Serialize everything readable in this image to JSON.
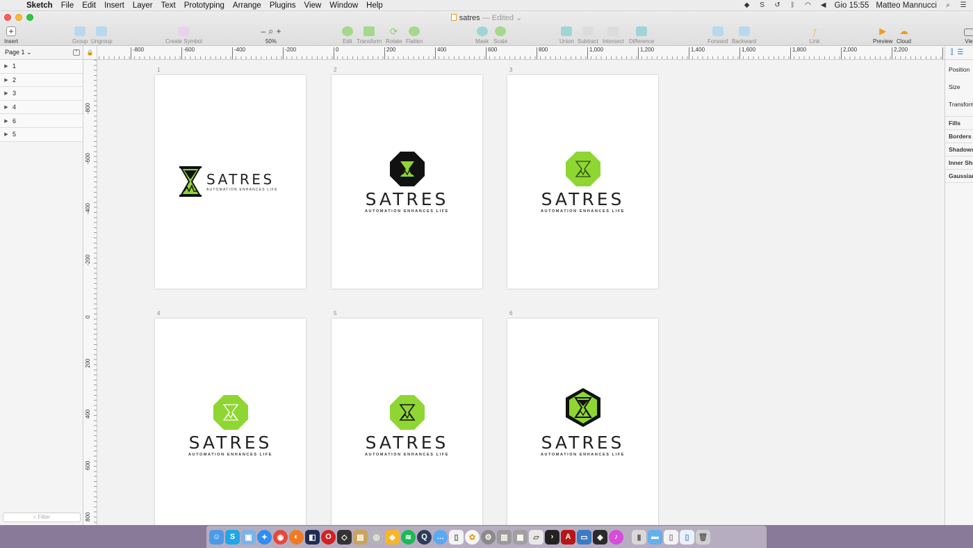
{
  "menubar": {
    "app": "Sketch",
    "items": [
      "File",
      "Edit",
      "Insert",
      "Layer",
      "Text",
      "Prototyping",
      "Arrange",
      "Plugins",
      "View",
      "Window",
      "Help"
    ],
    "clock": "Gio 15:55",
    "user": "Matteo Mannucci"
  },
  "window": {
    "doc_name": "satres",
    "doc_status": "— Edited ⌄"
  },
  "toolbar": {
    "insert": "Insert",
    "group": "Group",
    "ungroup": "Ungroup",
    "create_symbol": "Create Symbol",
    "zoom_minus": "–",
    "zoom_plus": "+",
    "zoom_level": "50%",
    "edit": "Edit",
    "transform": "Transform",
    "rotate": "Rotate",
    "flatten": "Flatten",
    "mask": "Mask",
    "scale": "Scale",
    "union": "Union",
    "subtract": "Subtract",
    "intersect": "Intersect",
    "difference": "Difference",
    "forward": "Forward",
    "backward": "Backward",
    "link": "Link",
    "preview": "Preview",
    "cloud": "Cloud",
    "view": "Vie"
  },
  "sidebar": {
    "page": "Page 1 ⌄",
    "layers": [
      "1",
      "2",
      "3",
      "4",
      "6",
      "5"
    ],
    "filter_placeholder": "Filter"
  },
  "ruler": {
    "top": [
      "-800",
      "-600",
      "-400",
      "-200",
      "0",
      "200",
      "400",
      "600",
      "800",
      "1,000",
      "1,200",
      "1,400",
      "1,600",
      "1,800",
      "2,000",
      "2,200",
      "2"
    ],
    "left": [
      "-800",
      "-600",
      "-400",
      "-200",
      "0",
      "200",
      "400",
      "600",
      "800"
    ]
  },
  "artboards": [
    {
      "label": "1",
      "brand": "SATRES",
      "tagline": "AUTOMATION ENHANCES LIFE",
      "style": "hourglass-horizontal"
    },
    {
      "label": "2",
      "brand": "SATRES",
      "tagline": "AUTOMATION ENHANCES LIFE",
      "style": "octagon-black"
    },
    {
      "label": "3",
      "brand": "SATRES",
      "tagline": "AUTOMATION ENHANCES LIFE",
      "style": "octagon-green"
    },
    {
      "label": "4",
      "brand": "SATRES",
      "tagline": "AUTOMATION ENHANCES LIFE",
      "style": "octagon-green"
    },
    {
      "label": "5",
      "brand": "SATRES",
      "tagline": "AUTOMATION ENHANCES LIFE",
      "style": "octagon-green-dark"
    },
    {
      "label": "6",
      "brand": "SATRES",
      "tagline": "AUTOMATION ENHANCES LIFE",
      "style": "hexagon-outline"
    }
  ],
  "inspector": {
    "position": "Position",
    "size": "Size",
    "transform": "Transform",
    "fills": "Fills",
    "borders": "Borders",
    "shadows": "Shadows",
    "inner_shadows": "Inner Sha",
    "gaussian": "Gaussian"
  },
  "colors": {
    "brand_green": "#8fd633",
    "brand_dark": "#111111"
  },
  "dock": [
    "finder-icon",
    "skype-icon",
    "preview-icon",
    "safari-icon",
    "chrome-icon",
    "firefox-icon",
    "sourcetree-icon",
    "opera-icon",
    "code-icon",
    "archive-icon",
    "disk-utility-icon",
    "sketch-icon",
    "spotify-icon",
    "quicktime-icon",
    "messages-icon",
    "textedit-icon",
    "photos-icon",
    "system-preferences-icon",
    "utility-icon",
    "utility2-icon",
    "utility3-icon",
    "terminal-icon",
    "acrobat-icon",
    "preview2-icon",
    "books-icon",
    "itunes-icon",
    "documents-icon",
    "folder-icon",
    "file-icon",
    "file2-icon",
    "trash-icon"
  ]
}
